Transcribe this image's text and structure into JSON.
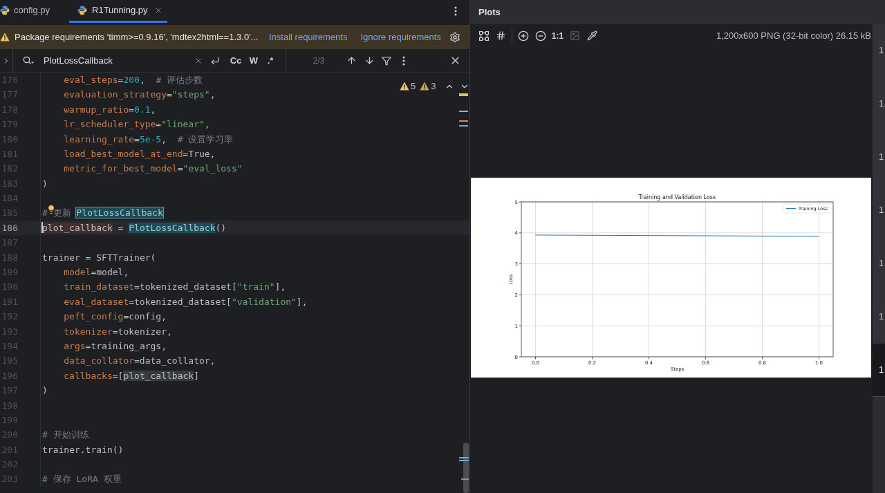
{
  "editor": {
    "tabs": [
      {
        "label": "config.py",
        "selected": false,
        "closable": false
      },
      {
        "label": "R1Tunning.py",
        "selected": true,
        "closable": true
      }
    ],
    "banner": {
      "message": "Package requirements 'timm>=0.9.16', 'mdtex2html==1.3.0'...",
      "actions": [
        "Install requirements",
        "Ignore requirements"
      ]
    },
    "find_bar": {
      "query": "PlotLossCallback",
      "options": [
        {
          "label": "Cc",
          "selected": false
        },
        {
          "label": "W",
          "selected": false
        },
        {
          "label": ".*",
          "selected": false
        }
      ],
      "match_count": "2/3"
    },
    "inspections": [
      {
        "kind": "warning",
        "count": "5"
      },
      {
        "kind": "weak_warning",
        "count": "3"
      }
    ],
    "lines": [
      {
        "number": "176",
        "indent": true,
        "current": false,
        "tokens": [
          {
            "kind": "param",
            "text": "eval_steps"
          },
          {
            "kind": "plain",
            "text": "="
          },
          {
            "kind": "number",
            "text": "200"
          },
          {
            "kind": "plain",
            "text": ",  "
          },
          {
            "kind": "comment",
            "text": "# 评估步数"
          }
        ]
      },
      {
        "number": "177",
        "indent": true,
        "current": false,
        "tokens": [
          {
            "kind": "param",
            "text": "evaluation_strategy"
          },
          {
            "kind": "plain",
            "text": "="
          },
          {
            "kind": "string",
            "text": "\"steps\""
          },
          {
            "kind": "plain",
            "text": ","
          }
        ]
      },
      {
        "number": "178",
        "indent": true,
        "current": false,
        "tokens": [
          {
            "kind": "param",
            "text": "warmup_ratio"
          },
          {
            "kind": "plain",
            "text": "="
          },
          {
            "kind": "number",
            "text": "0.1"
          },
          {
            "kind": "plain",
            "text": ","
          }
        ]
      },
      {
        "number": "179",
        "indent": true,
        "current": false,
        "tokens": [
          {
            "kind": "param",
            "text": "lr_scheduler_type"
          },
          {
            "kind": "plain",
            "text": "="
          },
          {
            "kind": "string",
            "text": "\"linear\""
          },
          {
            "kind": "plain",
            "text": ","
          }
        ]
      },
      {
        "number": "180",
        "indent": true,
        "current": false,
        "tokens": [
          {
            "kind": "param",
            "text": "learning_rate"
          },
          {
            "kind": "plain",
            "text": "="
          },
          {
            "kind": "number",
            "text": "5e-5"
          },
          {
            "kind": "plain",
            "text": ",  "
          },
          {
            "kind": "comment",
            "text": "# 设置学习率"
          }
        ]
      },
      {
        "number": "181",
        "indent": true,
        "current": false,
        "tokens": [
          {
            "kind": "param",
            "text": "load_best_model_at_end"
          },
          {
            "kind": "plain",
            "text": "=True,"
          }
        ]
      },
      {
        "number": "182",
        "indent": true,
        "current": false,
        "tokens": [
          {
            "kind": "param",
            "text": "metric_for_best_model"
          },
          {
            "kind": "plain",
            "text": "="
          },
          {
            "kind": "string",
            "text": "\"eval_loss\""
          }
        ]
      },
      {
        "number": "183",
        "indent": false,
        "current": false,
        "tokens": [
          {
            "kind": "plain",
            "text": ")"
          }
        ]
      },
      {
        "number": "184",
        "current": false
      },
      {
        "number": "185",
        "indent": false,
        "current": false,
        "lightbulb": true,
        "tokens": [
          {
            "kind": "comment",
            "text": "# 更新 "
          },
          {
            "kind": "comment",
            "text": "PlotLossCallback",
            "highlight": {
              "kind": "current_match"
            }
          }
        ]
      },
      {
        "number": "186",
        "indent": false,
        "current": true,
        "tokens": [
          {
            "kind": "plain",
            "text": "plot_callback",
            "highlight": {
              "kind": "identifier"
            }
          },
          {
            "kind": "plain",
            "text": " = "
          },
          {
            "kind": "plain",
            "text": "PlotLossCallback",
            "highlight": {
              "kind": "match"
            }
          },
          {
            "kind": "plain",
            "text": "()"
          }
        ]
      },
      {
        "number": "187",
        "current": false
      },
      {
        "number": "188",
        "indent": false,
        "current": false,
        "tokens": [
          {
            "kind": "plain",
            "text": "trainer = SFTTrainer("
          }
        ]
      },
      {
        "number": "189",
        "indent": true,
        "current": false,
        "tokens": [
          {
            "kind": "param",
            "text": "model"
          },
          {
            "kind": "plain",
            "text": "=model,"
          }
        ]
      },
      {
        "number": "190",
        "indent": true,
        "current": false,
        "tokens": [
          {
            "kind": "param",
            "text": "train_dataset"
          },
          {
            "kind": "plain",
            "text": "=tokenized_dataset["
          },
          {
            "kind": "string",
            "text": "\"train\""
          },
          {
            "kind": "plain",
            "text": "],"
          }
        ]
      },
      {
        "number": "191",
        "indent": true,
        "current": false,
        "tokens": [
          {
            "kind": "param",
            "text": "eval_dataset"
          },
          {
            "kind": "plain",
            "text": "=tokenized_dataset["
          },
          {
            "kind": "string",
            "text": "\"validation\""
          },
          {
            "kind": "plain",
            "text": "],"
          }
        ]
      },
      {
        "number": "192",
        "indent": true,
        "current": false,
        "tokens": [
          {
            "kind": "param",
            "text": "peft_config"
          },
          {
            "kind": "plain",
            "text": "=config,"
          }
        ]
      },
      {
        "number": "193",
        "indent": true,
        "current": false,
        "tokens": [
          {
            "kind": "param",
            "text": "tokenizer"
          },
          {
            "kind": "plain",
            "text": "=tokenizer,"
          }
        ]
      },
      {
        "number": "194",
        "indent": true,
        "current": false,
        "tokens": [
          {
            "kind": "param",
            "text": "args"
          },
          {
            "kind": "plain",
            "text": "=training_args,"
          }
        ]
      },
      {
        "number": "195",
        "indent": true,
        "current": false,
        "tokens": [
          {
            "kind": "param",
            "text": "data_collator"
          },
          {
            "kind": "plain",
            "text": "=data_collator,"
          }
        ]
      },
      {
        "number": "196",
        "indent": true,
        "current": false,
        "tokens": [
          {
            "kind": "param",
            "text": "callbacks"
          },
          {
            "kind": "plain",
            "text": "=["
          },
          {
            "kind": "plain",
            "text": "plot_callback",
            "highlight": {
              "kind": "usage"
            }
          },
          {
            "kind": "plain",
            "text": "]"
          }
        ]
      },
      {
        "number": "197",
        "indent": false,
        "current": false,
        "tokens": [
          {
            "kind": "plain",
            "text": ")"
          }
        ]
      },
      {
        "number": "198",
        "current": false
      },
      {
        "number": "199",
        "current": false
      },
      {
        "number": "200",
        "indent": false,
        "current": false,
        "tokens": [
          {
            "kind": "comment",
            "text": "# 开始训练"
          }
        ]
      },
      {
        "number": "201",
        "indent": false,
        "current": false,
        "tokens": [
          {
            "kind": "plain",
            "text": "trainer.train()"
          }
        ]
      },
      {
        "number": "202",
        "current": false
      },
      {
        "number": "203",
        "indent": false,
        "current": false,
        "tokens": [
          {
            "kind": "comment",
            "text": "# 保存 LoRA 权重"
          }
        ]
      }
    ]
  },
  "plots": {
    "title": "Plots",
    "zoom_label": "1:1",
    "image_info": "1,200x600 PNG (32-bit color) 26.15 kB",
    "chart_data": {
      "type": "line",
      "title": "Training and Validation Loss",
      "xlabel": "Steps",
      "ylabel": "Loss",
      "x": [
        0,
        1
      ],
      "series": [
        {
          "name": "Training Loss",
          "color": "#1f77b4",
          "values": [
            3.93,
            3.89
          ]
        }
      ],
      "xlim": [
        -0.05,
        1.05
      ],
      "ylim": [
        0,
        5
      ],
      "xticks": [
        {
          "value": 0,
          "label": "0.0"
        },
        {
          "value": 0.2,
          "label": "0.2"
        },
        {
          "value": 0.4,
          "label": "0.4"
        },
        {
          "value": 0.6,
          "label": "0.6"
        },
        {
          "value": 0.8,
          "label": "0.8"
        },
        {
          "value": 1,
          "label": "1.0"
        }
      ],
      "yticks": [
        0,
        1,
        2,
        3,
        4,
        5
      ],
      "grid": true
    },
    "thumbnails": [
      {
        "label": "1",
        "selected": false
      },
      {
        "label": "1",
        "selected": false
      },
      {
        "label": "1",
        "selected": false
      },
      {
        "label": "1",
        "selected": false
      },
      {
        "label": "1",
        "selected": false
      },
      {
        "label": "1",
        "selected": false
      },
      {
        "label": "1",
        "selected": true
      }
    ]
  }
}
